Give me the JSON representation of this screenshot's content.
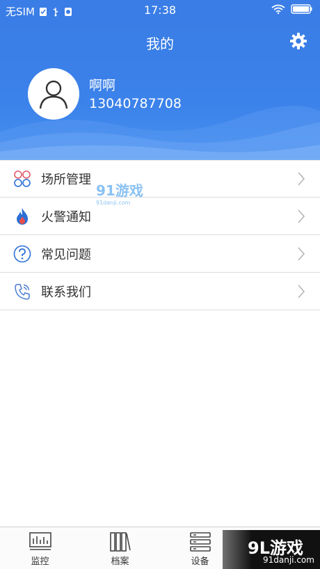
{
  "status_bar": {
    "carrier": "无SIM",
    "time": "17:38"
  },
  "header": {
    "title": "我的",
    "settings_icon": "gear-icon"
  },
  "user": {
    "name": "啊啊",
    "phone": "13040787708",
    "avatar_icon": "person-icon"
  },
  "menu": {
    "items": [
      {
        "label": "场所管理",
        "icon": "venue-icon"
      },
      {
        "label": "火警通知",
        "icon": "fire-icon"
      },
      {
        "label": "常见问题",
        "icon": "question-icon"
      },
      {
        "label": "联系我们",
        "icon": "phone-icon"
      }
    ]
  },
  "tabs": [
    {
      "label": "监控",
      "icon": "monitor-icon"
    },
    {
      "label": "档案",
      "icon": "archive-icon"
    },
    {
      "label": "设备",
      "icon": "device-icon"
    },
    {
      "label": "",
      "icon": ""
    }
  ],
  "watermark": {
    "mid_main": "91游戏",
    "mid_sub": "91danji.com",
    "corner_main": "9L游戏",
    "corner_sub": "91danji.com"
  },
  "colors": {
    "header_blue": "#3a7de6",
    "accent_blue": "#2b6fd6",
    "text": "#333333"
  }
}
